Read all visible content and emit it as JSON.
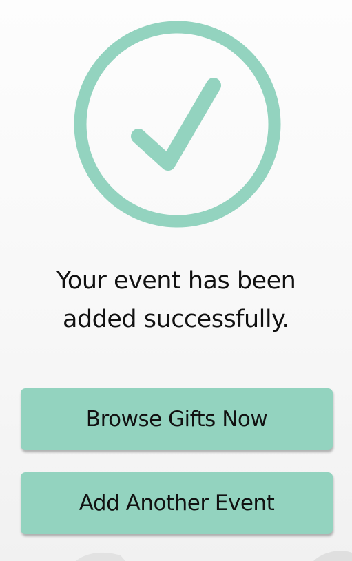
{
  "colors": {
    "accent": "#93d3bf",
    "text": "#111111",
    "background": "#f8f8f8"
  },
  "success": {
    "icon": "checkmark-circle-icon",
    "message_line1": "Your event has been",
    "message_line2": "added successfully."
  },
  "actions": {
    "browse_label": "Browse Gifts Now",
    "add_label": "Add Another Event"
  }
}
